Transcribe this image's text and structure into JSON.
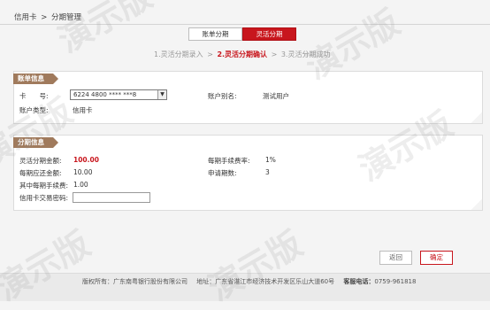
{
  "breadcrumb": {
    "root": "信用卡",
    "separator": ">",
    "current": "分期管理"
  },
  "tabs": [
    {
      "label": "账单分期",
      "active": false
    },
    {
      "label": "灵活分期",
      "active": true
    }
  ],
  "steps": [
    {
      "label": "1.灵活分期录入",
      "state": "done"
    },
    {
      "label": "2.灵活分期确认",
      "state": "current"
    },
    {
      "label": "3.灵活分期成功",
      "state": "pending"
    }
  ],
  "step_separator": ">",
  "account_panel": {
    "title": "账单信息",
    "card_label": "卡　　号:",
    "card_value": "6224 4800 **** ***8",
    "type_label": "账户类型:",
    "type_value": "信用卡",
    "alias_label": "账户别名:",
    "alias_value": "测试用户"
  },
  "install_panel": {
    "title": "分期信息",
    "amount_label": "灵活分期金额:",
    "amount_value": "100.00",
    "fee_rate_label": "每期手续费率:",
    "fee_rate_value": "1%",
    "repay_label": "每期应还金额:",
    "repay_value": "10.00",
    "periods_label": "申请期数:",
    "periods_value": "3",
    "fee_label": "其中每期手续费:",
    "fee_value": "1.00",
    "pwd_label": "信用卡交易密码:",
    "pwd_value": ""
  },
  "buttons": {
    "back": "返回",
    "confirm": "确定"
  },
  "footer": {
    "copyright": "版权所有：广东南粤银行股份有限公司",
    "address": "地址：广东省湛江市经济技术开发区乐山大道60号",
    "hotline_label": "客服电话：",
    "hotline": "0759-961818"
  },
  "watermark": "演示版",
  "colors": {
    "accent": "#c8161d",
    "panel_tag": "#a07a5c"
  }
}
